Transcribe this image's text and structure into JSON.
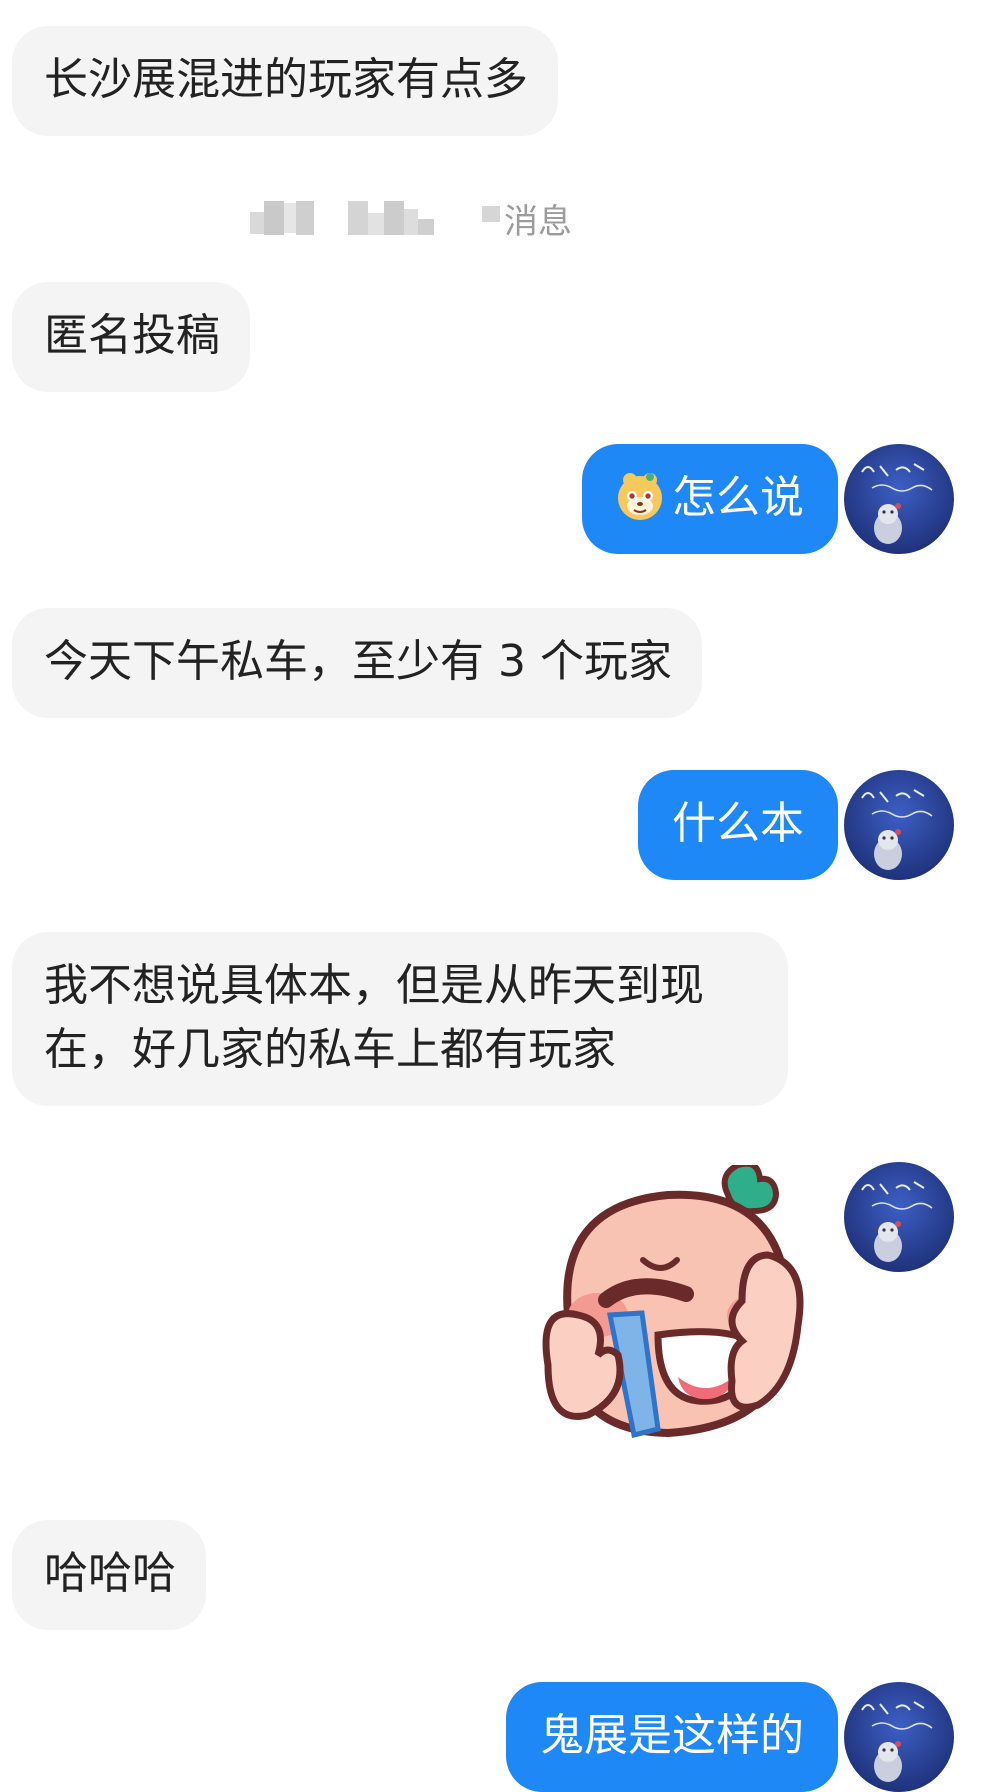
{
  "system_notice": {
    "label": "消息"
  },
  "messages": [
    {
      "side": "incoming",
      "text": "长沙展混进的玩家有点多"
    },
    {
      "side": "incoming",
      "text": "匿名投稿"
    },
    {
      "side": "outgoing",
      "text": "怎么说",
      "emoji": "mouse-face-emoji"
    },
    {
      "side": "incoming",
      "text": "今天下午私车，至少有 3 个玩家"
    },
    {
      "side": "outgoing",
      "text": "什么本"
    },
    {
      "side": "incoming",
      "text": "我不想说具体本，但是从昨天到现在，好几家的私车上都有玩家"
    },
    {
      "side": "outgoing",
      "sticker": "crying-peach-sticker"
    },
    {
      "side": "incoming",
      "text": "哈哈哈"
    },
    {
      "side": "outgoing",
      "text": "鬼展是这样的"
    }
  ],
  "avatar_icon": "night-sky-avatar",
  "colors": {
    "outgoing_bubble": "#1e88f6",
    "incoming_bubble": "#f4f4f4",
    "incoming_text": "#222222",
    "system_text": "#9c9c9c"
  }
}
